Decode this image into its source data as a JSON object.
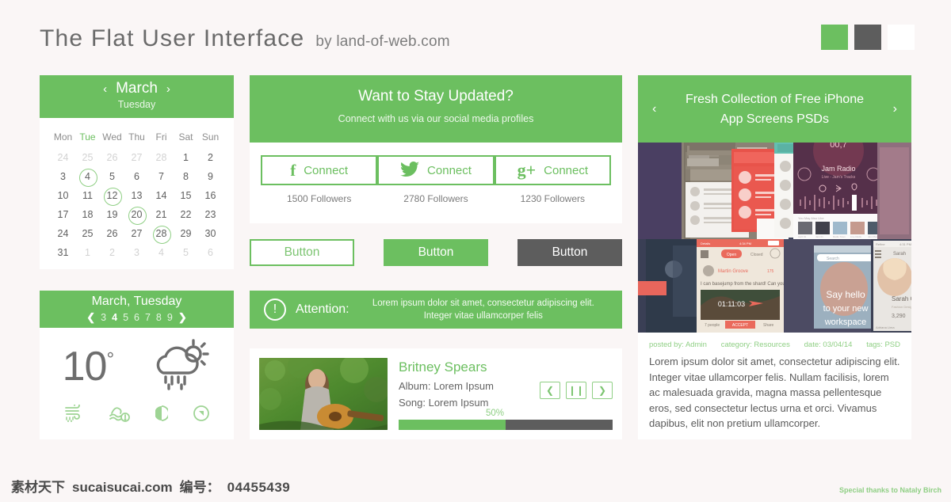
{
  "header": {
    "title": "The Flat  User  Interface",
    "byline": "by land-of-web.com",
    "swatches": [
      {
        "name": "green",
        "hex": "#6CBF60"
      },
      {
        "name": "dark",
        "hex": "#5D5D5D"
      },
      {
        "name": "white",
        "hex": "#FFFFFF"
      }
    ]
  },
  "calendar": {
    "prev": "‹",
    "next": "›",
    "month": "March",
    "weekday": "Tuesday",
    "day_headers": [
      "Mon",
      "Tue",
      "Wed",
      "Thu",
      "Fri",
      "Sat",
      "Sun"
    ],
    "active_day_header": "Tue",
    "weeks": [
      [
        {
          "n": "24",
          "muted": true
        },
        {
          "n": "25",
          "muted": true
        },
        {
          "n": "26",
          "muted": true
        },
        {
          "n": "27",
          "muted": true
        },
        {
          "n": "28",
          "muted": true
        },
        {
          "n": "1"
        },
        {
          "n": "2"
        }
      ],
      [
        {
          "n": "3"
        },
        {
          "n": "4",
          "circled": true
        },
        {
          "n": "5"
        },
        {
          "n": "6"
        },
        {
          "n": "7"
        },
        {
          "n": "8"
        },
        {
          "n": "9"
        }
      ],
      [
        {
          "n": "10"
        },
        {
          "n": "11"
        },
        {
          "n": "12",
          "circled": true
        },
        {
          "n": "13"
        },
        {
          "n": "14"
        },
        {
          "n": "15"
        },
        {
          "n": "16"
        }
      ],
      [
        {
          "n": "17"
        },
        {
          "n": "18"
        },
        {
          "n": "19"
        },
        {
          "n": "20",
          "circled": true
        },
        {
          "n": "21"
        },
        {
          "n": "22"
        },
        {
          "n": "23"
        }
      ],
      [
        {
          "n": "24"
        },
        {
          "n": "25"
        },
        {
          "n": "26"
        },
        {
          "n": "27"
        },
        {
          "n": "28",
          "circled": true
        },
        {
          "n": "29"
        },
        {
          "n": "30"
        }
      ],
      [
        {
          "n": "31"
        },
        {
          "n": "1",
          "muted": true
        },
        {
          "n": "2",
          "muted": true
        },
        {
          "n": "3",
          "muted": true
        },
        {
          "n": "4",
          "muted": true
        },
        {
          "n": "5",
          "muted": true
        },
        {
          "n": "6",
          "muted": true
        }
      ]
    ]
  },
  "weather": {
    "title": "March, Tuesday",
    "prev": "❮",
    "next": "❯",
    "days": [
      "3",
      "4",
      "5",
      "6",
      "7",
      "8",
      "9"
    ],
    "active_day": "4",
    "temperature": "10",
    "degree": "°",
    "condition_icon": "sun-cloud-rain-icon",
    "footer_icons": [
      "rain-wind-icon",
      "waves-warning-icon",
      "moon-phase-icon",
      "compass-icon"
    ]
  },
  "social": {
    "title": "Want to Stay Updated?",
    "subtitle": "Connect with us via our social media profiles",
    "items": [
      {
        "icon": "facebook-icon",
        "glyph": "f",
        "label": "Connect",
        "followers": "1500 Followers"
      },
      {
        "icon": "twitter-icon",
        "glyph": "",
        "label": "Connect",
        "followers": "2780 Followers"
      },
      {
        "icon": "google-plus-icon",
        "glyph": "g+",
        "label": "Connect",
        "followers": "1230 Followers"
      }
    ]
  },
  "buttons": [
    {
      "label": "Button",
      "style": "ghost"
    },
    {
      "label": "Button",
      "style": "solid"
    },
    {
      "label": "Button",
      "style": "dark"
    }
  ],
  "attention": {
    "icon": "exclamation-circle-icon",
    "glyph": "!",
    "label": "Attention:",
    "text": "Lorem ipsum dolor sit amet, consectetur adipiscing elit. Integer vitae ullamcorper felis"
  },
  "music": {
    "artist": "Britney Spears",
    "album": "Album: Lorem Ipsum",
    "song": "Song: Lorem Ipsum",
    "progress_label": "50%",
    "progress_value": 50,
    "controls": [
      {
        "name": "previous-track-button",
        "glyph": "❮"
      },
      {
        "name": "pause-button",
        "glyph": "❙❙"
      },
      {
        "name": "next-track-button",
        "glyph": "❯"
      }
    ]
  },
  "promo": {
    "prev": "‹",
    "next": "›",
    "title_line1": "Fresh Collection of Free iPhone",
    "title_line2": "App Screens PSDs",
    "meta": [
      "posted by: Admin",
      "category: Resources",
      "date: 03/04/14",
      "tags: PSD"
    ],
    "body": "Lorem ipsum dolor sit amet, consectetur adipiscing elit. Integer vitae ullamcorper felis. Nullam facilisis, lorem ac malesuada gravida, magna massa pellentesque eros, sed consectetur lectus urna et orci. Vivamus dapibus, elit non pretium ullamcorper."
  },
  "footer": {
    "watermark_cn": "素材天下",
    "watermark_site": "sucaisucai.com",
    "watermark_label": "编号：",
    "watermark_number": "04455439",
    "thanks": "Special thanks to Nataly Birch"
  },
  "colors": {
    "accent_green": "#6CBF60",
    "dark_gray": "#5D5D5D",
    "page_bg": "#FAF6F6",
    "card_bg": "#FFFFFF"
  }
}
